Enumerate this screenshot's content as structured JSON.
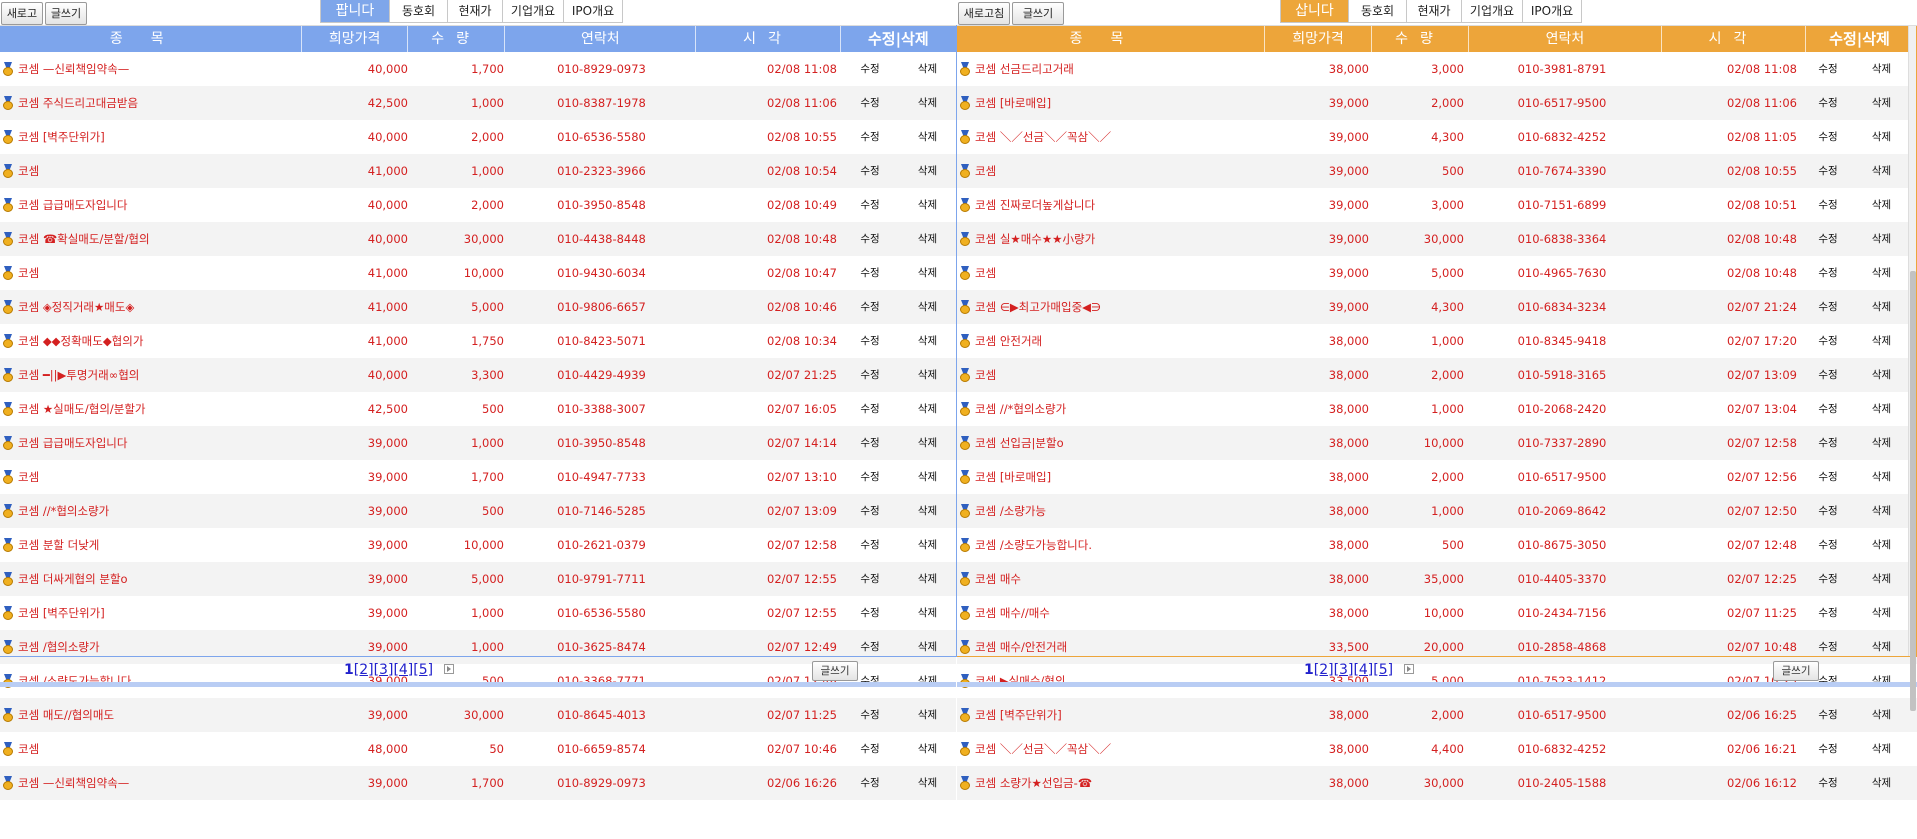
{
  "left": {
    "toolbar": {
      "refresh_label": "새로고침",
      "write_label": "글쓰기"
    },
    "tabs": [
      "팝니다",
      "동호회",
      "현재가",
      "기업개요",
      "IPO개요"
    ],
    "headers": {
      "item": "종목",
      "price": "희망가격",
      "qty": "수량",
      "contact": "연락처",
      "time": "시각",
      "edit": "수정|삭제"
    },
    "rows": [
      {
        "item": "코셈 —신뢰책임약속—",
        "price": "40,000",
        "qty": "1,700",
        "phone": "010-8929-0973",
        "time": "02/08 11:08"
      },
      {
        "item": "코셈 주식드리고대금받음",
        "price": "42,500",
        "qty": "1,000",
        "phone": "010-8387-1978",
        "time": "02/08 11:06"
      },
      {
        "item": "코셈 [벽주단위가]",
        "price": "40,000",
        "qty": "2,000",
        "phone": "010-6536-5580",
        "time": "02/08 10:55"
      },
      {
        "item": "코셈",
        "price": "41,000",
        "qty": "1,000",
        "phone": "010-2323-3966",
        "time": "02/08 10:54"
      },
      {
        "item": "코셈 급급매도자입니다",
        "price": "40,000",
        "qty": "2,000",
        "phone": "010-3950-8548",
        "time": "02/08 10:49"
      },
      {
        "item": "코셈 ☎확실매도/분할/협의",
        "price": "40,000",
        "qty": "30,000",
        "phone": "010-4438-8448",
        "time": "02/08 10:48"
      },
      {
        "item": "코셈",
        "price": "41,000",
        "qty": "10,000",
        "phone": "010-9430-6034",
        "time": "02/08 10:47"
      },
      {
        "item": "코셈 ◈정직거래★매도◈",
        "price": "41,000",
        "qty": "5,000",
        "phone": "010-9806-6657",
        "time": "02/08 10:46"
      },
      {
        "item": "코셈 ◆◆정확매도◆협의가",
        "price": "41,000",
        "qty": "1,750",
        "phone": "010-8423-5071",
        "time": "02/08 10:34"
      },
      {
        "item": "코셈 ━||▶투명거래∞협의",
        "price": "40,000",
        "qty": "3,300",
        "phone": "010-4429-4939",
        "time": "02/07 21:25"
      },
      {
        "item": "코셈 ★실매도/협의/분할가",
        "price": "42,500",
        "qty": "500",
        "phone": "010-3388-3007",
        "time": "02/07 16:05"
      },
      {
        "item": "코셈 급급매도자입니다",
        "price": "39,000",
        "qty": "1,000",
        "phone": "010-3950-8548",
        "time": "02/07 14:14"
      },
      {
        "item": "코셈",
        "price": "39,000",
        "qty": "1,700",
        "phone": "010-4947-7733",
        "time": "02/07 13:10"
      },
      {
        "item": "코셈 //*협의소량가",
        "price": "39,000",
        "qty": "500",
        "phone": "010-7146-5285",
        "time": "02/07 13:09"
      },
      {
        "item": "코셈 분할 더낮게",
        "price": "39,000",
        "qty": "10,000",
        "phone": "010-2621-0379",
        "time": "02/07 12:58"
      },
      {
        "item": "코셈 더싸게협의 분할o",
        "price": "39,000",
        "qty": "5,000",
        "phone": "010-9791-7711",
        "time": "02/07 12:55"
      },
      {
        "item": "코셈 [벽주단위가]",
        "price": "39,000",
        "qty": "1,000",
        "phone": "010-6536-5580",
        "time": "02/07 12:55"
      },
      {
        "item": "코셈 /협의소량가",
        "price": "39,000",
        "qty": "1,000",
        "phone": "010-3625-8474",
        "time": "02/07 12:49"
      },
      {
        "item": "코셈 /소량도가능합니다.",
        "price": "39,000",
        "qty": "500",
        "phone": "010-3368-7771",
        "time": "02/07 12:48"
      },
      {
        "item": "코셈 매도//협의매도",
        "price": "39,000",
        "qty": "30,000",
        "phone": "010-8645-4013",
        "time": "02/07 11:25"
      },
      {
        "item": "코셈",
        "price": "48,000",
        "qty": "50",
        "phone": "010-6659-8574",
        "time": "02/07 10:46"
      },
      {
        "item": "코셈 —신뢰책임약속—",
        "price": "39,000",
        "qty": "1,700",
        "phone": "010-8929-0973",
        "time": "02/06 16:26"
      }
    ],
    "row_edit": "수정",
    "row_delete": "삭제",
    "pager": {
      "current": "1",
      "pages": [
        "[2]",
        "[3]",
        "[4]",
        "[5]"
      ]
    },
    "footer_write": "글쓰기"
  },
  "right": {
    "toolbar": {
      "refresh_label": "새로고침",
      "write_label": "글쓰기"
    },
    "tabs": [
      "삽니다",
      "동호회",
      "현재가",
      "기업개요",
      "IPO개요"
    ],
    "headers": {
      "item": "종목",
      "price": "희망가격",
      "qty": "수량",
      "contact": "연락처",
      "time": "시각",
      "edit": "수정|삭제"
    },
    "rows": [
      {
        "item": "코셈 선금드리고거래",
        "price": "38,000",
        "qty": "3,000",
        "phone": "010-3981-8791",
        "time": "02/08 11:08"
      },
      {
        "item": "코셈 [바로매입]",
        "price": "39,000",
        "qty": "2,000",
        "phone": "010-6517-9500",
        "time": "02/08 11:06"
      },
      {
        "item": "코셈 ＼／선금＼／꼭삼＼／",
        "price": "39,000",
        "qty": "4,300",
        "phone": "010-6832-4252",
        "time": "02/08 11:05"
      },
      {
        "item": "코셈",
        "price": "39,000",
        "qty": "500",
        "phone": "010-7674-3390",
        "time": "02/08 10:55"
      },
      {
        "item": "코셈 진짜로더높게삽니다",
        "price": "39,000",
        "qty": "3,000",
        "phone": "010-7151-6899",
        "time": "02/08 10:51"
      },
      {
        "item": "코셈 실★매수★★小량가",
        "price": "39,000",
        "qty": "30,000",
        "phone": "010-6838-3364",
        "time": "02/08 10:48"
      },
      {
        "item": "코셈",
        "price": "39,000",
        "qty": "5,000",
        "phone": "010-4965-7630",
        "time": "02/08 10:48"
      },
      {
        "item": "코셈 ∈▶최고가매입중◀∋",
        "price": "39,000",
        "qty": "4,300",
        "phone": "010-6834-3234",
        "time": "02/07 21:24"
      },
      {
        "item": "코셈 안전거래",
        "price": "38,000",
        "qty": "1,000",
        "phone": "010-8345-9418",
        "time": "02/07 17:20"
      },
      {
        "item": "코셈",
        "price": "38,000",
        "qty": "2,000",
        "phone": "010-5918-3165",
        "time": "02/07 13:09"
      },
      {
        "item": "코셈 //*협의소량가",
        "price": "38,000",
        "qty": "1,000",
        "phone": "010-2068-2420",
        "time": "02/07 13:04"
      },
      {
        "item": "코셈 선입금|분할o",
        "price": "38,000",
        "qty": "10,000",
        "phone": "010-7337-2890",
        "time": "02/07 12:58"
      },
      {
        "item": "코셈 [바로매입]",
        "price": "38,000",
        "qty": "2,000",
        "phone": "010-6517-9500",
        "time": "02/07 12:56"
      },
      {
        "item": "코셈 /소량가능",
        "price": "38,000",
        "qty": "1,000",
        "phone": "010-2069-8642",
        "time": "02/07 12:50"
      },
      {
        "item": "코셈 /소량도가능합니다.",
        "price": "38,000",
        "qty": "500",
        "phone": "010-8675-3050",
        "time": "02/07 12:48"
      },
      {
        "item": "코셈 매수",
        "price": "38,000",
        "qty": "35,000",
        "phone": "010-4405-3370",
        "time": "02/07 12:25"
      },
      {
        "item": "코셈 매수//매수",
        "price": "38,000",
        "qty": "10,000",
        "phone": "010-2434-7156",
        "time": "02/07 11:25"
      },
      {
        "item": "코셈 매수/안전거래",
        "price": "33,500",
        "qty": "20,000",
        "phone": "010-2858-4868",
        "time": "02/07 10:48"
      },
      {
        "item": "코셈 ▶실매수/협의",
        "price": "33,500",
        "qty": "5,000",
        "phone": "010-7523-1412",
        "time": "02/07 10:25"
      },
      {
        "item": "코셈 [벽주단위가]",
        "price": "38,000",
        "qty": "2,000",
        "phone": "010-6517-9500",
        "time": "02/06 16:25"
      },
      {
        "item": "코셈 ＼／선금＼／꼭삼＼／",
        "price": "38,000",
        "qty": "4,400",
        "phone": "010-6832-4252",
        "time": "02/06 16:21"
      },
      {
        "item": "코셈 소량가★선입금-☎",
        "price": "38,000",
        "qty": "30,000",
        "phone": "010-2405-1588",
        "time": "02/06 16:12"
      }
    ],
    "row_edit": "수정",
    "row_delete": "삭제",
    "pager": {
      "current": "1",
      "pages": [
        "[2]",
        "[3]",
        "[4]",
        "[5]"
      ]
    },
    "footer_write": "글쓰기"
  },
  "colors": {
    "sell_accent": "#7da5ec",
    "buy_accent": "#eda53a",
    "value_red": "#d42020"
  },
  "icons": {
    "row_icon": "medal-icon",
    "pager_next": "next-page-icon"
  }
}
